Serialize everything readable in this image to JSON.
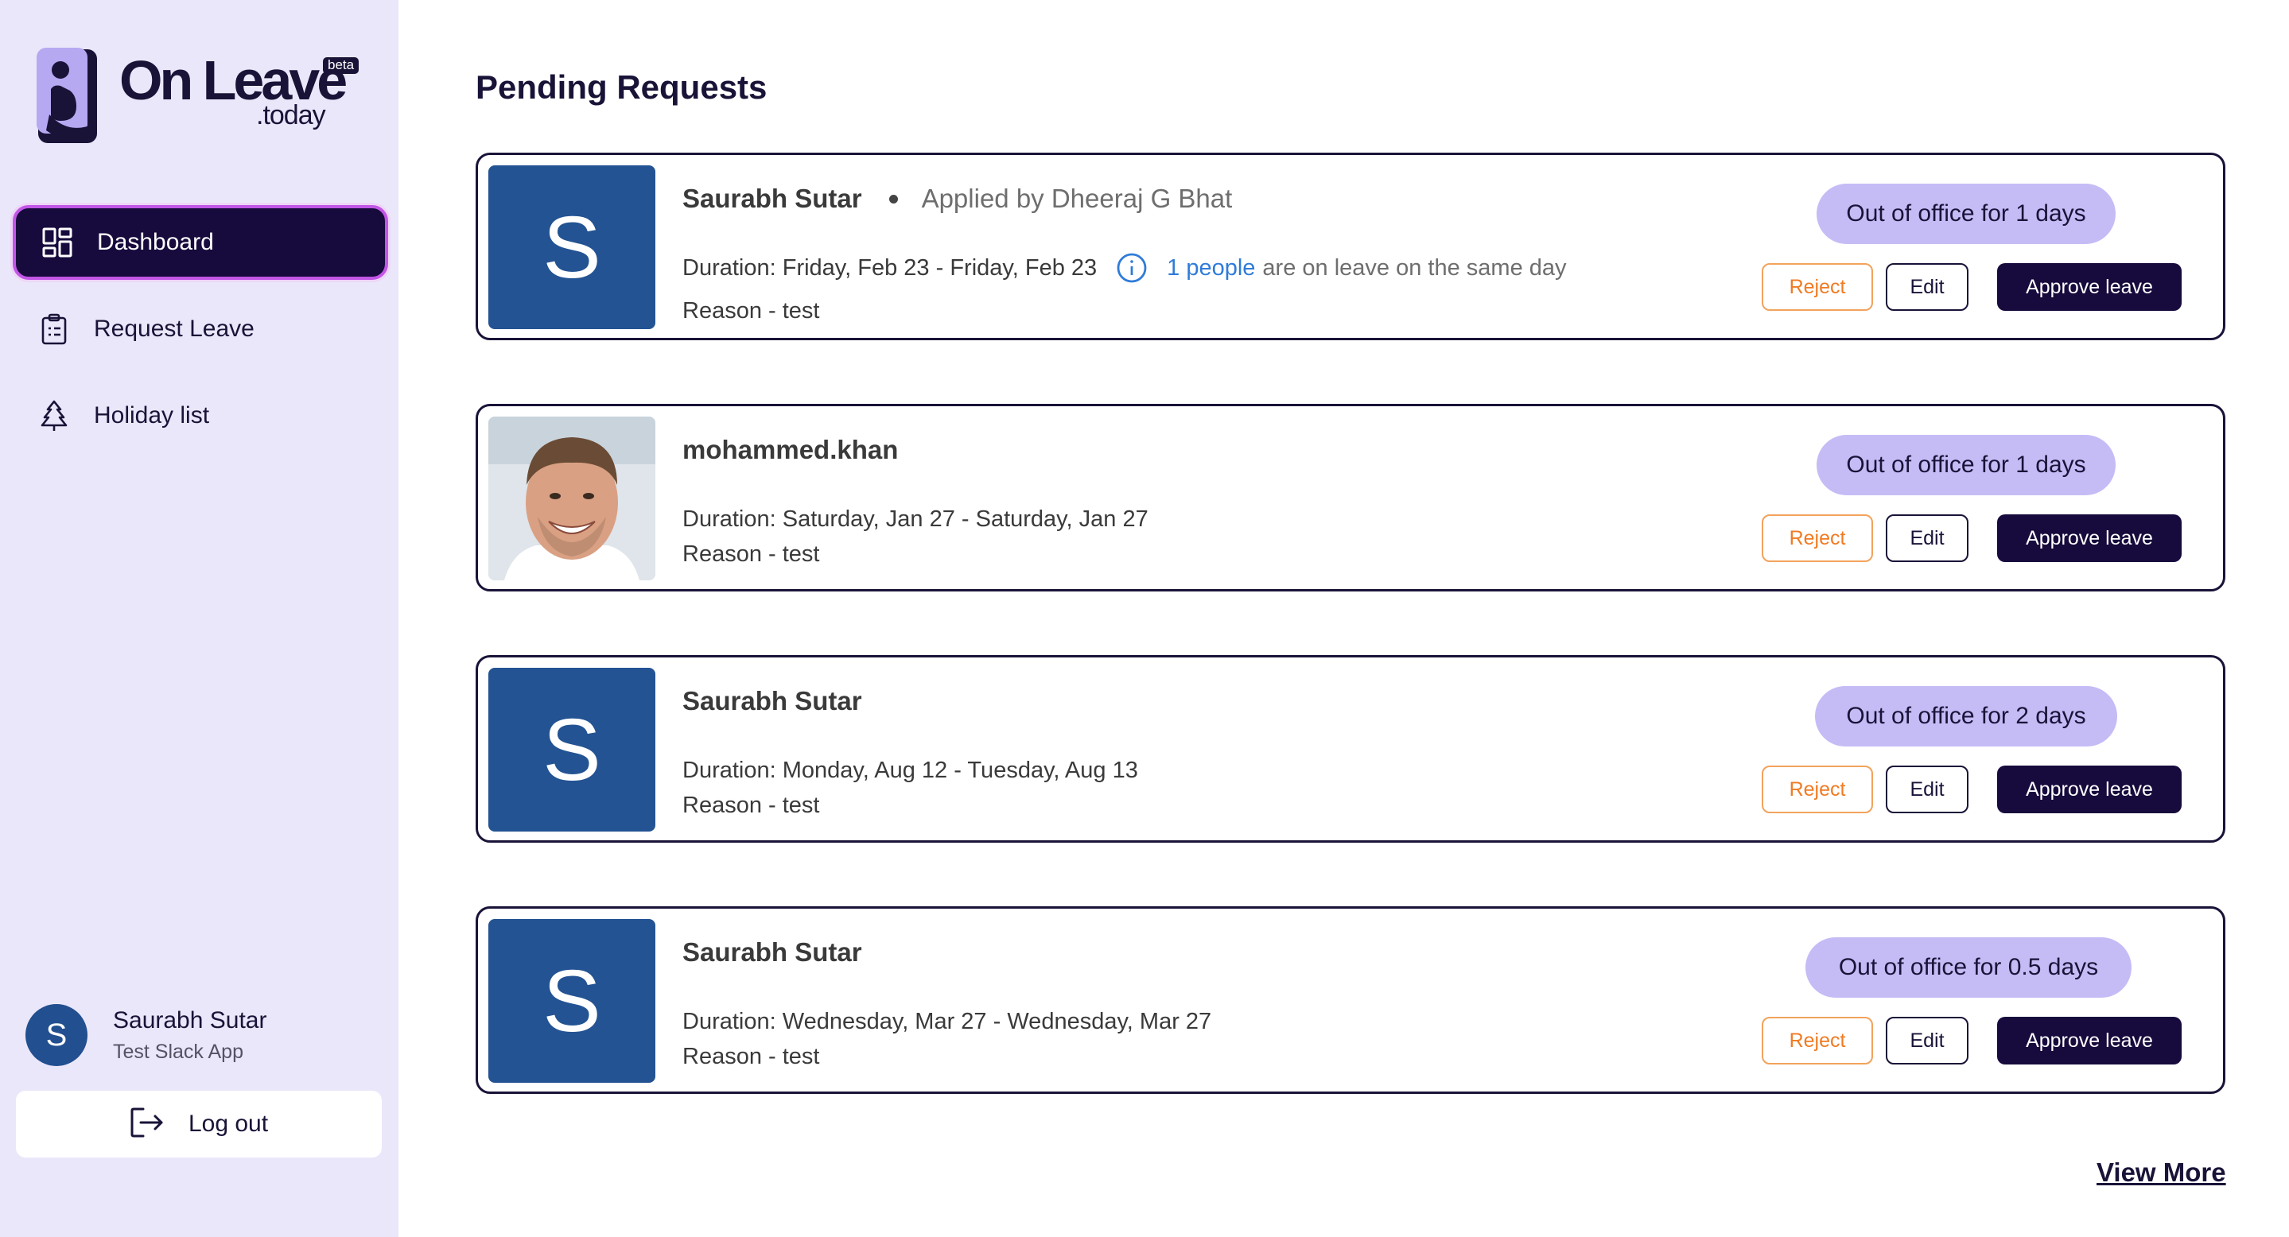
{
  "app": {
    "logo_text": "On Leave",
    "logo_sub": ".today",
    "logo_badge": "beta"
  },
  "sidebar": {
    "items": [
      {
        "label": "Dashboard",
        "icon": "dashboard-grid-icon",
        "active": true
      },
      {
        "label": "Request Leave",
        "icon": "clipboard-icon",
        "active": false
      },
      {
        "label": "Holiday list",
        "icon": "tree-icon",
        "active": false
      }
    ],
    "profile": {
      "initial": "S",
      "name": "Saurabh Sutar",
      "subtitle": "Test Slack App"
    },
    "logout_label": "Log out"
  },
  "main": {
    "title": "Pending Requests",
    "requests": [
      {
        "initial": "S",
        "name": "Saurabh Sutar",
        "applied_by": "Applied by Dheeraj G Bhat",
        "duration": "Duration: Friday, Feb 23 - Friday, Feb 23",
        "overlap_link": "1 people",
        "overlap_text": "are on leave on the same day",
        "reason": "Reason - test",
        "ooo": "Out of office for 1 days"
      },
      {
        "initial": "",
        "name": "mohammed.khan",
        "duration": "Duration: Saturday, Jan 27 - Saturday, Jan 27",
        "reason": "Reason - test",
        "ooo": "Out of office for 1 days"
      },
      {
        "initial": "S",
        "name": "Saurabh Sutar",
        "duration": "Duration: Monday, Aug 12 - Tuesday, Aug 13",
        "reason": "Reason - test",
        "ooo": "Out of office for 2 days"
      },
      {
        "initial": "S",
        "name": "Saurabh Sutar",
        "duration": "Duration: Wednesday, Mar 27 - Wednesday, Mar 27",
        "reason": "Reason - test",
        "ooo": "Out of office for 0.5 days"
      }
    ],
    "buttons": {
      "reject": "Reject",
      "edit": "Edit",
      "approve": "Approve leave"
    },
    "view_more": "View More"
  },
  "colors": {
    "sidebar_bg": "#ebe7fa",
    "primary_dark": "#170a3c",
    "active_border": "#c256e6",
    "ooo_pill": "#c5bcf6",
    "avatar_blue": "#235393",
    "reject_orange": "#f07b23",
    "link_blue": "#2f7bd8"
  }
}
